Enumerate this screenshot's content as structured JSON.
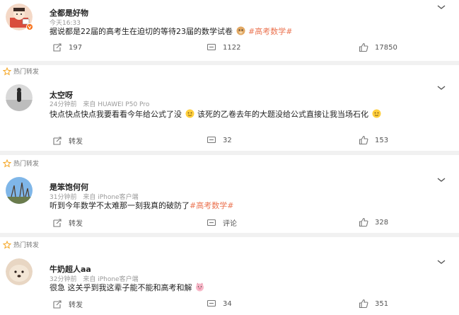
{
  "posts": [
    {
      "hot": "",
      "username": "全都是好物",
      "time": "今天16:33",
      "source": "",
      "text": "据说都是22届的高考生在迫切的等待23届的数学试卷",
      "tag": "#高考数学#",
      "text_after": "",
      "repost": "197",
      "comment": "1122",
      "like": "17850"
    },
    {
      "hot": "热门转发",
      "username": "太空呀",
      "time": "24分钟前",
      "source": "来自 HUAWEI P50 Pro",
      "text": "快点快点快点我要看看今年给公式了没",
      "text_mid": "该死的乙卷去年的大题没给公式直接让我当场石化",
      "repost": "转发",
      "comment": "32",
      "like": "153"
    },
    {
      "hot": "热门转发",
      "username": "是笨饱何何",
      "time": "31分钟前",
      "source": "来自 iPhone客户端",
      "text": "听到今年数学不太难那一刻我真的破防了",
      "tag": "#高考数学#",
      "repost": "转发",
      "comment": "评论",
      "like": "328"
    },
    {
      "hot": "热门转发",
      "username": "牛奶超人aa",
      "time": "32分钟前",
      "source": "来自 iPhone客户端",
      "text": "很急 这关乎到我这辈子能不能和高考和解",
      "repost": "转发",
      "comment": "34",
      "like": "351"
    }
  ],
  "icons": [
    "fire-icon",
    "chevron-down-icon",
    "repost-icon",
    "comment-icon",
    "like-icon",
    "vip-badge-icon"
  ],
  "colors": {
    "accent": "#eb7350",
    "hot": "#f5a623",
    "meta": "#9a9a9a",
    "divider": "#f1f1f1"
  }
}
